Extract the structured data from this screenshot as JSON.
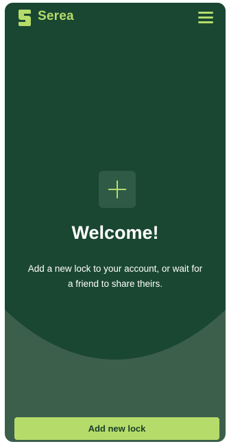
{
  "header": {
    "brand_name": "Serea",
    "logo_icon": "serea-s-logo-icon",
    "menu_icon": "hamburger-menu-icon"
  },
  "empty_state": {
    "add_icon": "plus-icon",
    "title": "Welcome!",
    "message": "Add a new lock to your account, or wait for a friend to share theirs."
  },
  "footer": {
    "add_button_label": "Add new lock"
  },
  "colors": {
    "accent": "#b5dc6a",
    "background_dark": "#1a4732",
    "background_light": "#3c5f4b",
    "tile": "#2f5a45",
    "text": "#ffffff"
  }
}
